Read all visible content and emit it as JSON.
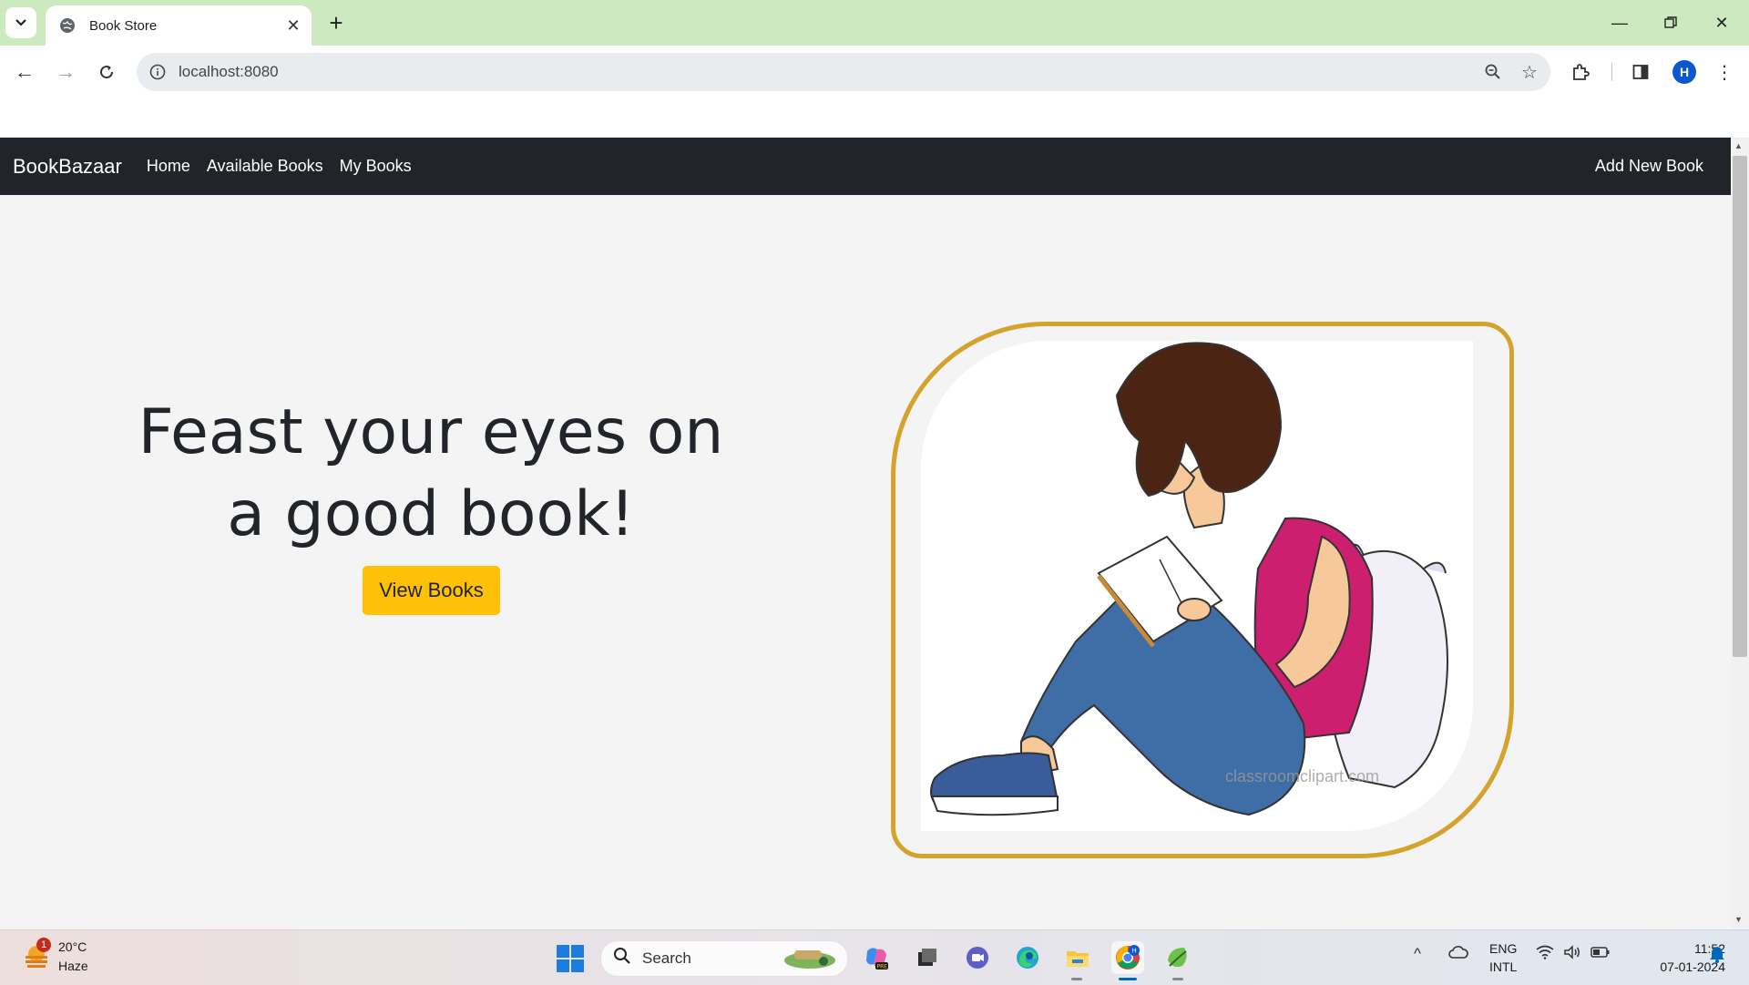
{
  "browser": {
    "tab_title": "Book Store",
    "new_tab": "+",
    "url": "localhost:8080",
    "profile_initial": "H"
  },
  "site": {
    "brand": "BookBazaar",
    "nav_links": [
      "Home",
      "Available Books",
      "My Books"
    ],
    "add_new": "Add New Book",
    "hero_line1": "Feast your eyes on",
    "hero_line2": "a good book!",
    "hero_button": "View Books",
    "watermark": "classroomclipart.com"
  },
  "taskbar": {
    "weather_badge": "1",
    "weather_temp": "20°C",
    "weather_desc": "Haze",
    "search_label": "Search",
    "lang_line1": "ENG",
    "lang_line2": "INTL",
    "time": "11:52",
    "date": "07-01-2024"
  },
  "colors": {
    "navbar": "#212529",
    "accent_button": "#ffc107",
    "frame_border": "#d4a32c",
    "tab_strip": "#cde9bf"
  }
}
